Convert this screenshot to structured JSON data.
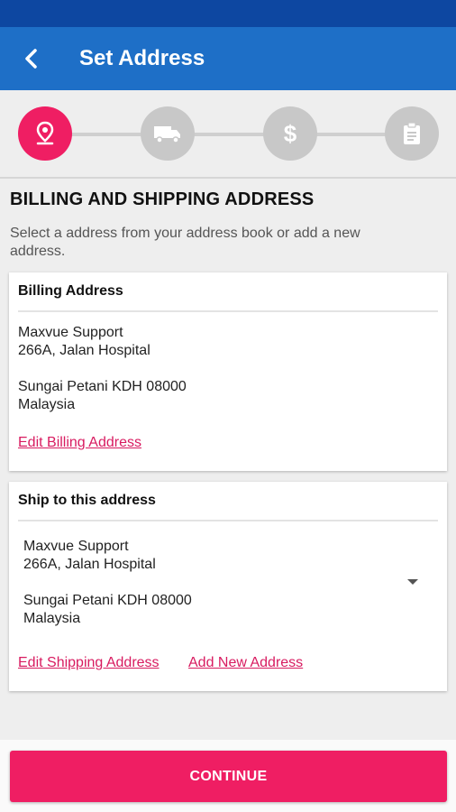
{
  "app_bar": {
    "title": "Set Address",
    "back_icon": "back-arrow-icon"
  },
  "stepper": {
    "steps": [
      {
        "icon": "location-pin-icon",
        "active": true
      },
      {
        "icon": "truck-icon",
        "active": false
      },
      {
        "icon": "dollar-icon",
        "glyph": "$",
        "active": false
      },
      {
        "icon": "clipboard-icon",
        "active": false
      }
    ],
    "active_color": "#ef1e63",
    "inactive_color": "#c8c8c8"
  },
  "section": {
    "title": "BILLING AND SHIPPING ADDRESS",
    "description": "Select a address from your address book or add a new address."
  },
  "billing": {
    "header": "Billing Address",
    "name": "Maxvue Support",
    "street": "266A, Jalan Hospital",
    "city_line": "Sungai Petani KDH 08000",
    "country": "Malaysia",
    "edit_link": "Edit Billing Address"
  },
  "shipping": {
    "header": "Ship to this address",
    "name": "Maxvue Support",
    "street": "266A, Jalan Hospital",
    "city_line": "Sungai Petani KDH 08000",
    "country": "Malaysia",
    "edit_link": "Edit Shipping Address",
    "add_link": "Add New Address"
  },
  "continue_label": "CONTINUE",
  "colors": {
    "primary": "#1e6fc7",
    "accent": "#ef1e63",
    "link": "#d81b60"
  }
}
